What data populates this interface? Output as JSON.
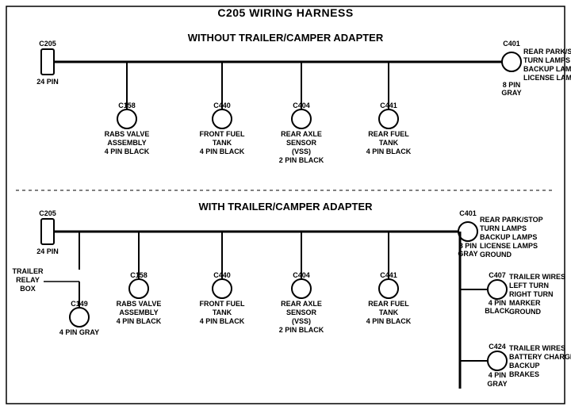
{
  "title": "C205 WIRING HARNESS",
  "section1": {
    "label": "WITHOUT TRAILER/CAMPER ADAPTER",
    "left_connector": {
      "id": "C205",
      "pins": "24 PIN"
    },
    "right_connector": {
      "id": "C401",
      "pins": "8 PIN",
      "color": "GRAY",
      "desc": "REAR PARK/STOP\nTURN LAMPS\nBACKUP LAMPS\nLICENSE LAMPS"
    },
    "connectors": [
      {
        "id": "C158",
        "desc": "RABS VALVE\nASSEMBLY\n4 PIN BLACK"
      },
      {
        "id": "C440",
        "desc": "FRONT FUEL\nTANK\n4 PIN BLACK"
      },
      {
        "id": "C404",
        "desc": "REAR AXLE\nSENSOR\n(VSS)\n2 PIN BLACK"
      },
      {
        "id": "C441",
        "desc": "REAR FUEL\nTANK\n4 PIN BLACK"
      }
    ]
  },
  "section2": {
    "label": "WITH TRAILER/CAMPER ADAPTER",
    "left_connector": {
      "id": "C205",
      "pins": "24 PIN"
    },
    "right_connector": {
      "id": "C401",
      "pins": "8 PIN",
      "color": "GRAY",
      "desc": "REAR PARK/STOP\nTURN LAMPS\nBACKUP LAMPS\nLICENSE LAMPS\nGROUND"
    },
    "trailer_relay": {
      "label": "TRAILER\nRELAY\nBOX"
    },
    "c149": {
      "id": "C149",
      "desc": "4 PIN GRAY"
    },
    "connectors": [
      {
        "id": "C158",
        "desc": "RABS VALVE\nASSEMBLY\n4 PIN BLACK"
      },
      {
        "id": "C440",
        "desc": "FRONT FUEL\nTANK\n4 PIN BLACK"
      },
      {
        "id": "C404",
        "desc": "REAR AXLE\nSENSOR\n(VSS)\n2 PIN BLACK"
      },
      {
        "id": "C441",
        "desc": "REAR FUEL\nTANK\n4 PIN BLACK"
      }
    ],
    "right_connectors": [
      {
        "id": "C407",
        "pins": "4 PIN",
        "color": "BLACK",
        "desc": "TRAILER WIRES\nLEFT TURN\nRIGHT TURN\nMARKER\nGROUND"
      },
      {
        "id": "C424",
        "pins": "4 PIN",
        "color": "GRAY",
        "desc": "TRAILER WIRES\nBATTERY CHARGE\nBACKUP\nBRAKES"
      }
    ]
  }
}
